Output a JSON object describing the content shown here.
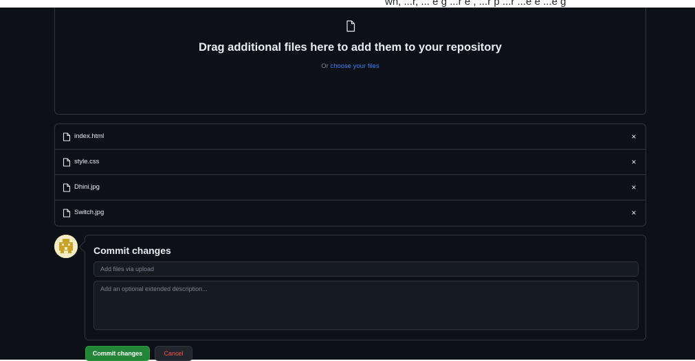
{
  "header_text": "o o r, ... , o o ...r e e p ...",
  "dropzone": {
    "icon": "file-icon",
    "title": "Drag additional files here to add them to your repository",
    "prompt": "Or",
    "choose_link": "choose your files"
  },
  "files": [
    {
      "name": "index.html",
      "icon": "file-icon"
    },
    {
      "name": "style.css",
      "icon": "file-icon"
    },
    {
      "name": "Dhini.jpg",
      "icon": "file-icon"
    },
    {
      "name": "Switch.jpg",
      "icon": "file-icon"
    }
  ],
  "remove_label": "×",
  "commit": {
    "title": "Commit changes",
    "summary_placeholder": "Add files via upload",
    "description_placeholder": "Add an optional extended description...",
    "commit_button": "Commit changes",
    "cancel_button": "Cancel"
  },
  "colors": {
    "background": "#0d1117",
    "border": "#30363d",
    "link": "#2f81f7",
    "commit_button": "#238636",
    "cancel_text": "#f85149"
  }
}
